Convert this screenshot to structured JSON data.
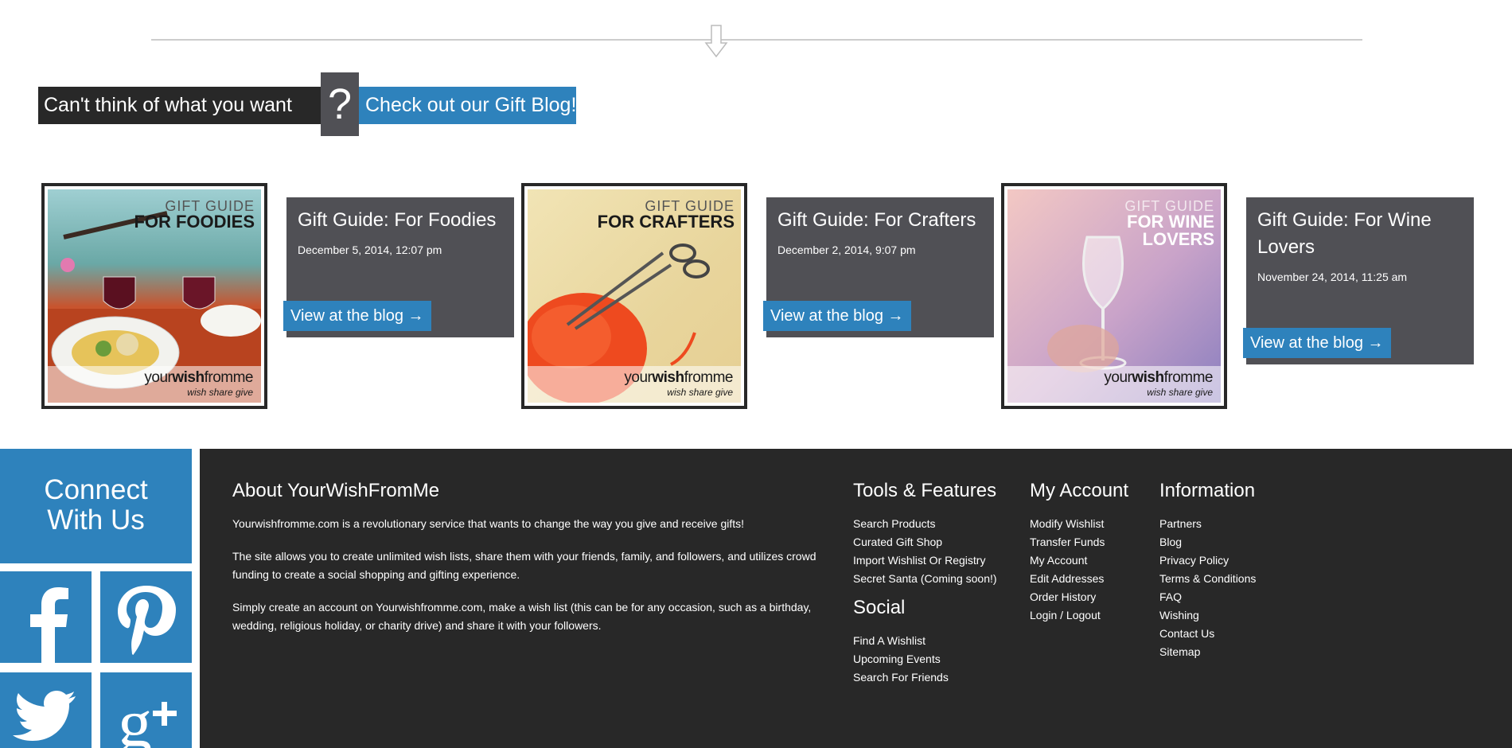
{
  "colors": {
    "accent": "#2e82bc",
    "dark": "#282828",
    "card": "#505055"
  },
  "divider": {
    "icon": "down-arrow-icon"
  },
  "gift_banner": {
    "text": "Can't think of what you want",
    "question_mark": "?",
    "link": "Check out our Gift Blog!"
  },
  "blog_posts": [
    {
      "title": "Gift Guide: For Foodies",
      "date": "December 5, 2014, 12:07 pm",
      "button": "View at the blog →",
      "image_label_small": "GIFT GUIDE",
      "image_label_big": "FOR FOODIES",
      "logo_a": "your",
      "logo_b": "wish",
      "logo_c": "fromme",
      "logo_tag": "wish  share  give"
    },
    {
      "title": "Gift Guide: For Crafters",
      "date": "December 2, 2014, 9:07 pm",
      "button": "View at the blog →",
      "image_label_small": "GIFT GUIDE",
      "image_label_big": "FOR CRAFTERS",
      "logo_a": "your",
      "logo_b": "wish",
      "logo_c": "fromme",
      "logo_tag": "wish  share  give"
    },
    {
      "title": "Gift Guide: For Wine Lovers",
      "date": "November 24, 2014, 11:25 am",
      "button": "View at the blog →",
      "image_label_small": "GIFT GUIDE",
      "image_label_big_1": "FOR WINE",
      "image_label_big_2": "LOVERS",
      "logo_a": "your",
      "logo_b": "wish",
      "logo_c": "fromme",
      "logo_tag": "wish  share  give"
    }
  ],
  "footer": {
    "connect_line1": "Connect",
    "connect_line2": "With Us",
    "social_icons": [
      "facebook-icon",
      "pinterest-icon",
      "twitter-icon",
      "google-plus-icon"
    ],
    "about": {
      "heading": "About YourWishFromMe",
      "paragraphs": [
        "Yourwishfromme.com is a revolutionary service that wants to change the way you give and receive gifts!",
        "The site allows you to create unlimited wish lists, share them with your friends, family, and followers, and utilizes crowd funding to create a social shopping and gifting experience.",
        "Simply create an account on Yourwishfromme.com, make a wish list (this can be for any occasion, such as a birthday, wedding, religious holiday, or charity drive) and share it with your followers."
      ]
    },
    "tools": {
      "heading": "Tools & Features",
      "items": [
        "Search Products",
        "Curated Gift Shop",
        "Import Wishlist Or Registry",
        "Secret Santa (Coming soon!)"
      ]
    },
    "social": {
      "heading": "Social",
      "items": [
        "Find A Wishlist",
        "Upcoming Events",
        "Search For Friends"
      ]
    },
    "account": {
      "heading": "My Account",
      "items": [
        "Modify Wishlist",
        "Transfer Funds",
        "My Account",
        "Edit Addresses",
        "Order History",
        "Login / Logout"
      ]
    },
    "information": {
      "heading": "Information",
      "items": [
        "Partners",
        "Blog",
        "Privacy Policy",
        "Terms & Conditions",
        "FAQ",
        "Wishing",
        "Contact Us",
        "Sitemap"
      ]
    }
  }
}
